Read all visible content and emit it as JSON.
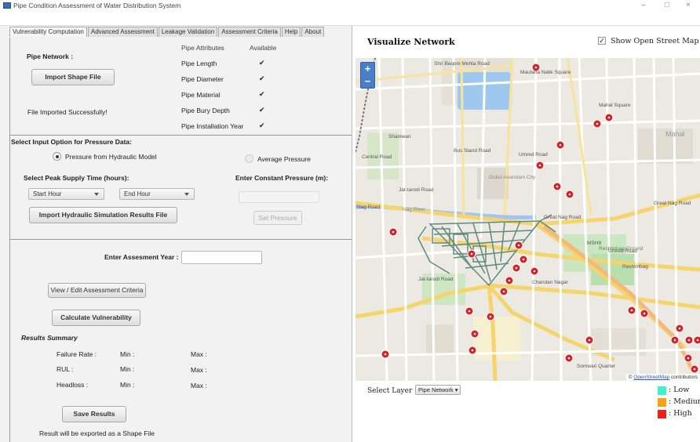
{
  "window": {
    "title": "Pipe Condition Assessment of Water Distribution System",
    "minimize": "–",
    "maximize": "□",
    "close": "×"
  },
  "tabs": [
    "Vulnerability Computation",
    "Advanced Assessment",
    "Leakage Validation",
    "Assessment Criteria",
    "Help",
    "About"
  ],
  "pipe_network": {
    "heading": "Pipe Network :",
    "import_button": "Import Shape File",
    "status": "File Imported Successfully!",
    "attributes_header": "Pipe Attributes",
    "available_header": "Available",
    "attributes": [
      {
        "name": "Pipe Length",
        "available": "✔"
      },
      {
        "name": "Pipe Diameter",
        "available": "✔"
      },
      {
        "name": "Pipe Material",
        "available": "✔"
      },
      {
        "name": "Pipe Bury Depth",
        "available": "✔"
      },
      {
        "name": "Pipe Installation Year",
        "available": "✔"
      }
    ]
  },
  "pressure": {
    "heading": "Select Input Option for Pressure Data:",
    "option_hydraulic": "Pressure from Hydraulic Model",
    "option_average": "Average Pressure",
    "selected": "hydraulic",
    "peak_label": "Select Peak Supply Time (hours):",
    "start_hour": "Start Hour",
    "end_hour": "End Hour",
    "import_button": "Import Hydraulic Simulation Results File",
    "constant_label": "Enter Constant Pressure (m):",
    "constant_value": "",
    "set_button": "Set Pressure"
  },
  "assessment": {
    "year_label": "Enter Assesment Year :",
    "year_value": "",
    "view_criteria_button": "View / Edit Assessment Criteria",
    "calculate_button": "Calculate Vulnerability",
    "summary_heading": "Results Summary",
    "rows": [
      {
        "label": "Failure Rate :",
        "min": "Min :",
        "max": "Max :"
      },
      {
        "label": "RUL :",
        "min": "Min :",
        "max": "Max :"
      },
      {
        "label": "Headloss :",
        "min": "Min :",
        "max": "Max :"
      }
    ],
    "save_button": "Save Results",
    "export_note": "Result will be exported as a Shape File"
  },
  "visualize": {
    "title": "Visualize Network",
    "osm_checked": true,
    "osm_check_glyph": "✓",
    "osm_label": "Show Open Street Map",
    "zoom_in": "+",
    "zoom_out": "−",
    "attribution_prefix": "©",
    "attribution_link": "OpenStreetMap",
    "attribution_suffix": " contributors",
    "select_layer_label": "Select Layer :",
    "layer_value": "Pipe Network",
    "layer_arrow": "▾",
    "legend": [
      {
        "label": ": Low",
        "color": "#3ef2cf"
      },
      {
        "label": ": Medium",
        "color": "#f5a30f"
      },
      {
        "label": ": High",
        "color": "#ee1f1f"
      }
    ]
  },
  "map_labels": [
    "Shri Beqoni Mehta Road",
    "Maulana Natik Square",
    "Mahal Square",
    "Mahal",
    "Shaniwari",
    "Great Nag Road",
    "Great Nag Road",
    "Nag Road",
    "Nag River",
    "Jat-tarodi Road",
    "Chandan Nagar",
    "Reshimbag",
    "Reshimbag Ground",
    "MSH9",
    "Umred Road",
    "Somwari Quarter",
    "Gokul Anandam City",
    "Central Road",
    "Bus Stand Road",
    "Umred Road",
    "Jat-tarodi Road"
  ],
  "colors": {
    "marker": "#d3232a",
    "river": "#9fc5f0",
    "pipe": "#5f8b80",
    "major_road": "#f6d46c"
  }
}
